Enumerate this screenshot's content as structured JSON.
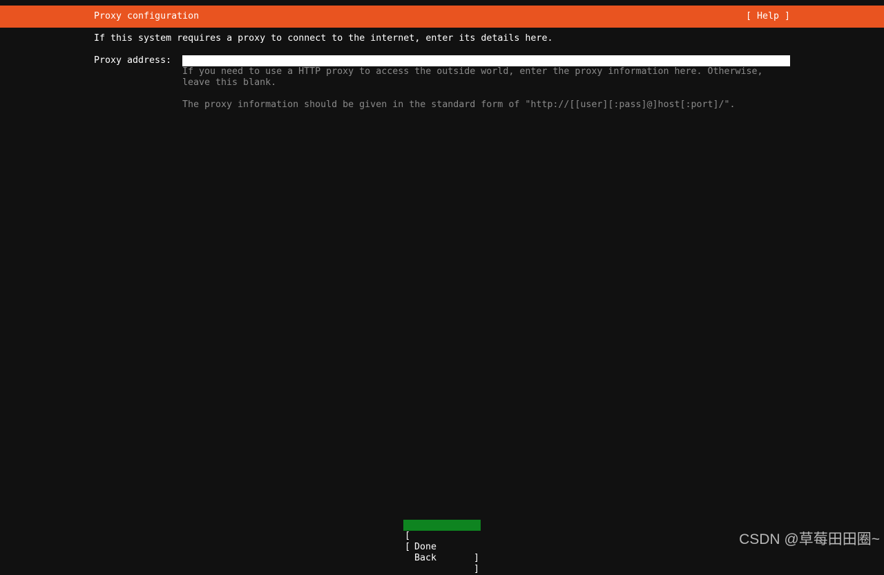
{
  "header": {
    "title": "Proxy configuration",
    "help_label": "[ Help ]"
  },
  "intro": "If this system requires a proxy to connect to the internet, enter its details here.",
  "proxy": {
    "label": "Proxy address:",
    "value": "",
    "help_line1": "If you need to use a HTTP proxy to access the outside world, enter the proxy information here. Otherwise,",
    "help_line2": "leave this blank.",
    "help_line3": "The proxy information should be given in the standard form of \"http://[[user][:pass]@]host[:port]/\"."
  },
  "buttons": {
    "bracket_open": "[",
    "bracket_close": "]",
    "done": "Done",
    "back": "Back"
  },
  "colors": {
    "accent": "#e95420",
    "focus": "#0e8420",
    "background": "#111111"
  },
  "watermark": "CSDN @草莓田田圈~"
}
